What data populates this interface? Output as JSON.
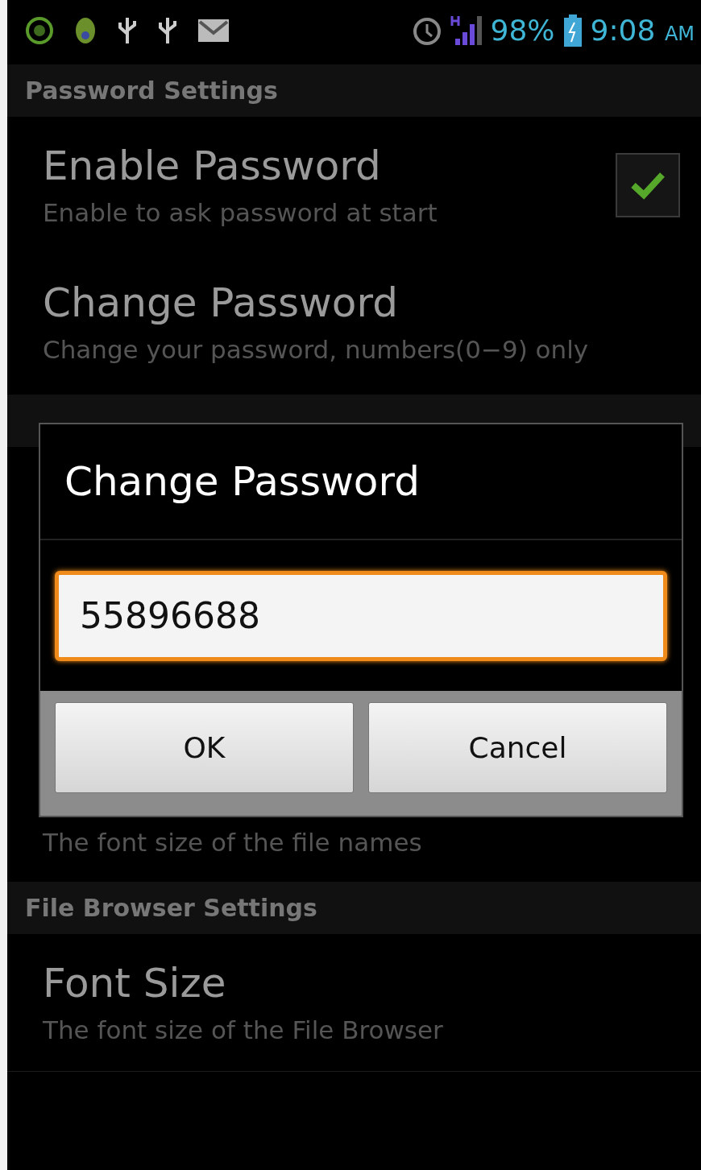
{
  "status_bar": {
    "battery": "98%",
    "time": "9:08",
    "meridiem": "AM"
  },
  "sections": [
    {
      "title": "Password Settings",
      "items": [
        {
          "title": "Enable Password",
          "summary": "Enable to ask password at start",
          "kind": "checkbox",
          "checked": true
        },
        {
          "title": "Change Password",
          "summary": "Change your password, numbers(0−9) only",
          "kind": "plain"
        }
      ]
    },
    {
      "items": [
        {
          "summary": "The font size of the file names",
          "kind": "covered"
        }
      ]
    },
    {
      "title": "File Browser Settings",
      "items": [
        {
          "title": "Font Size",
          "summary": "The font size of the File Browser",
          "kind": "plain"
        }
      ]
    }
  ],
  "dialog": {
    "title": "Change Password",
    "input": {
      "value": "55896688",
      "focused": true
    },
    "buttons": [
      {
        "label": "OK"
      },
      {
        "label": "Cancel"
      }
    ]
  }
}
